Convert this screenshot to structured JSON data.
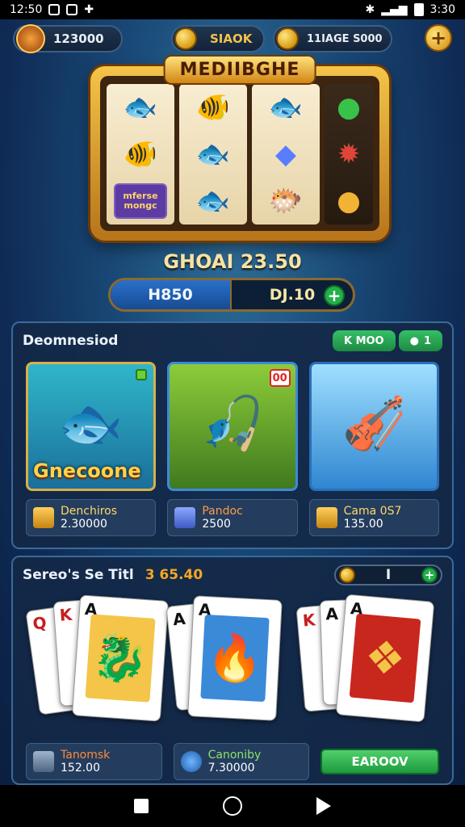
{
  "statusbar": {
    "time": "12:50",
    "right_time": "3:30"
  },
  "topbar": {
    "player_value": "123000",
    "coin_label": "SIAOK",
    "gems_value": "11IAGE S000"
  },
  "slot": {
    "title": "MEDIIBGHE",
    "reels": [
      {
        "symbols": [
          "🐟",
          "🐠",
          "🐡"
        ]
      },
      {
        "symbols": [
          "🐠",
          "🐟",
          "🐟"
        ]
      },
      {
        "symbols": [
          "🐟",
          "◆",
          "🐡"
        ]
      },
      {
        "symbols": [
          "●",
          "✹",
          "●"
        ]
      }
    ],
    "box_text_1": "mferse",
    "box_text_2": "mongc"
  },
  "jackpot_text": "GHOAI 23.50",
  "balance": {
    "left": "H850",
    "right": "DJ.10"
  },
  "games_panel": {
    "title": "Deomnesiod",
    "pill1": "K MOO",
    "pill2": "1",
    "tiles": [
      {
        "label": "Gnecoone",
        "art": "🐟",
        "badge": ""
      },
      {
        "label": "",
        "art": "🎣",
        "badge": "00"
      },
      {
        "label": "",
        "art": "🎻",
        "badge": ""
      }
    ],
    "info": [
      {
        "name": "Denchiros",
        "value": "2.30000"
      },
      {
        "name": "Pandoc",
        "value": "2500"
      },
      {
        "name": "Cama 0S7",
        "value": "135.00"
      }
    ]
  },
  "cards_panel": {
    "title": "Sereo's Se Titl",
    "amount": "3 65.40",
    "bet_value": "I",
    "groups": [
      {
        "art": "🐉",
        "cards": [
          "Q",
          "K",
          "A"
        ]
      },
      {
        "art": "🔥",
        "cards": [
          "A",
          "A"
        ]
      },
      {
        "art": "❖",
        "cards": [
          "K",
          "A",
          "A"
        ]
      }
    ],
    "info": [
      {
        "name": "Tanomsk",
        "value": "152.00"
      },
      {
        "name": "Canoniby",
        "value": "7.30000"
      }
    ],
    "button": "EAROOV"
  },
  "colors": {
    "accent_gold": "#f4c548",
    "accent_green": "#21b04a",
    "panel": "#14284a"
  }
}
